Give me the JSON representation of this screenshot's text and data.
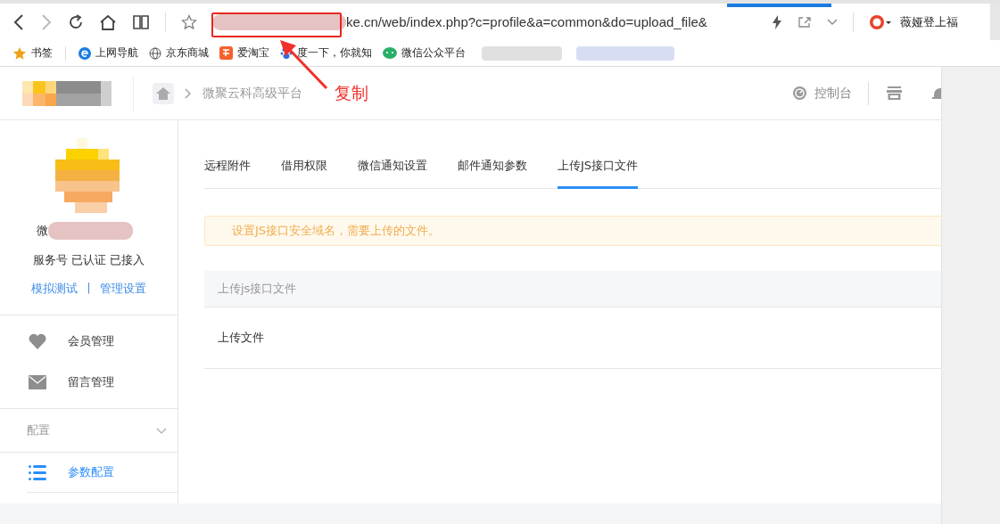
{
  "browser": {
    "url": "ke.cn/web/index.php?c=profile&a=common&do=upload_file&",
    "profile": "薇娅登上福",
    "bookmarks": [
      {
        "label": "书签",
        "kind": "star"
      },
      {
        "label": "上网导航",
        "kind": "browser"
      },
      {
        "label": "京东商城",
        "kind": "globe"
      },
      {
        "label": "爱淘宝",
        "kind": "shop"
      },
      {
        "label": "度一下，你就知",
        "kind": "paw"
      },
      {
        "label": "微信公众平台",
        "kind": "chat"
      }
    ]
  },
  "header": {
    "breadcrumb": "微聚云科高级平台",
    "console": "控制台"
  },
  "annotation": {
    "label": "复制"
  },
  "sidebar": {
    "account_name": "微",
    "account_status": "服务号 已认证 已接入",
    "links": [
      "模拟测试",
      "管理设置"
    ],
    "links_separator": "|",
    "items": [
      {
        "label": "会员管理",
        "kind": "heart"
      },
      {
        "label": "留言管理",
        "kind": "mail"
      }
    ],
    "section": {
      "title": "配置",
      "expanded": true,
      "items": [
        {
          "label": "参数配置",
          "selected": true
        }
      ]
    }
  },
  "tabs": [
    {
      "label": "远程附件",
      "selected": false
    },
    {
      "label": "借用权限",
      "selected": false
    },
    {
      "label": "微信通知设置",
      "selected": false
    },
    {
      "label": "邮件通知参数",
      "selected": false
    },
    {
      "label": "上传JS接口文件",
      "selected": true
    }
  ],
  "notice": "设置JS接口安全域名，需要上传的文件。",
  "panel": {
    "title": "上传js接口文件",
    "rows": [
      "上传文件"
    ]
  }
}
